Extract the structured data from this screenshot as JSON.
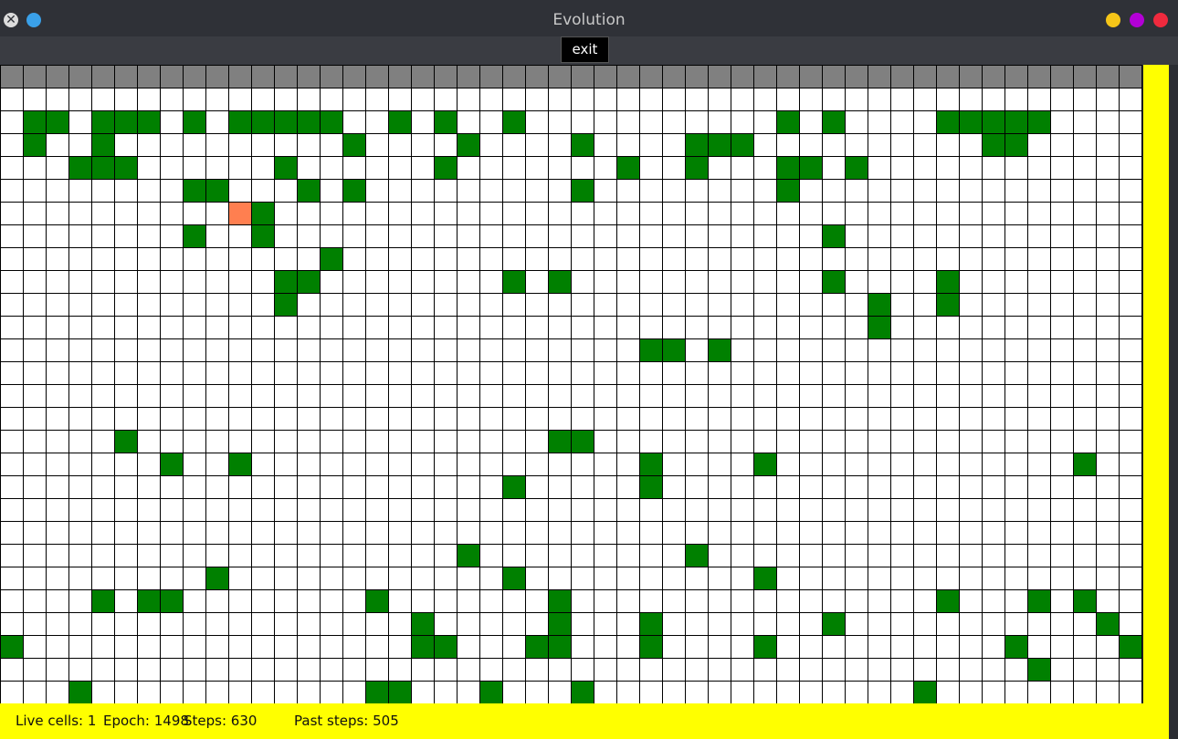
{
  "window": {
    "title": "Evolution",
    "close_icon": "close-icon",
    "left_dot_color": "#3aa0e8",
    "right_dots": [
      "#f5c518",
      "#b300d6",
      "#f02a3e"
    ]
  },
  "toolbar": {
    "exit_label": "exit"
  },
  "board": {
    "columns": 50,
    "rows": 27,
    "colors": {
      "border": "#808080",
      "empty": "#ffffff",
      "live": "#008000",
      "agent": "#ff7f50",
      "grid_line": "#000000",
      "background": "#ffff00"
    },
    "green_cells": [
      [
        1,
        1
      ],
      [
        1,
        2
      ],
      [
        1,
        4
      ],
      [
        1,
        5
      ],
      [
        1,
        6
      ],
      [
        1,
        8
      ],
      [
        1,
        10
      ],
      [
        1,
        11
      ],
      [
        1,
        12
      ],
      [
        1,
        13
      ],
      [
        1,
        14
      ],
      [
        1,
        17
      ],
      [
        1,
        19
      ],
      [
        1,
        22
      ],
      [
        1,
        34
      ],
      [
        1,
        36
      ],
      [
        1,
        41
      ],
      [
        1,
        42
      ],
      [
        1,
        43
      ],
      [
        1,
        44
      ],
      [
        1,
        45
      ],
      [
        2,
        1
      ],
      [
        2,
        4
      ],
      [
        2,
        15
      ],
      [
        2,
        20
      ],
      [
        2,
        25
      ],
      [
        2,
        30
      ],
      [
        2,
        31
      ],
      [
        2,
        32
      ],
      [
        2,
        43
      ],
      [
        2,
        44
      ],
      [
        3,
        3
      ],
      [
        3,
        4
      ],
      [
        3,
        5
      ],
      [
        3,
        12
      ],
      [
        3,
        19
      ],
      [
        3,
        27
      ],
      [
        3,
        30
      ],
      [
        3,
        34
      ],
      [
        3,
        35
      ],
      [
        3,
        37
      ],
      [
        4,
        8
      ],
      [
        4,
        9
      ],
      [
        4,
        13
      ],
      [
        4,
        15
      ],
      [
        4,
        25
      ],
      [
        4,
        34
      ],
      [
        5,
        11
      ],
      [
        6,
        8
      ],
      [
        6,
        11
      ],
      [
        6,
        36
      ],
      [
        7,
        14
      ],
      [
        8,
        12
      ],
      [
        8,
        13
      ],
      [
        8,
        22
      ],
      [
        8,
        24
      ],
      [
        8,
        36
      ],
      [
        8,
        41
      ],
      [
        9,
        12
      ],
      [
        9,
        38
      ],
      [
        9,
        41
      ],
      [
        10,
        38
      ],
      [
        11,
        28
      ],
      [
        11,
        29
      ],
      [
        11,
        31
      ],
      [
        15,
        5
      ],
      [
        15,
        24
      ],
      [
        15,
        25
      ],
      [
        16,
        7
      ],
      [
        16,
        10
      ],
      [
        16,
        28
      ],
      [
        16,
        33
      ],
      [
        16,
        47
      ],
      [
        17,
        22
      ],
      [
        17,
        28
      ],
      [
        20,
        20
      ],
      [
        20,
        30
      ],
      [
        21,
        9
      ],
      [
        21,
        22
      ],
      [
        21,
        33
      ],
      [
        22,
        4
      ],
      [
        22,
        6
      ],
      [
        22,
        7
      ],
      [
        22,
        16
      ],
      [
        22,
        24
      ],
      [
        22,
        41
      ],
      [
        22,
        45
      ],
      [
        22,
        47
      ],
      [
        23,
        18
      ],
      [
        23,
        24
      ],
      [
        23,
        28
      ],
      [
        23,
        36
      ],
      [
        23,
        48
      ],
      [
        24,
        0
      ],
      [
        24,
        18
      ],
      [
        24,
        19
      ],
      [
        24,
        23
      ],
      [
        24,
        24
      ],
      [
        24,
        28
      ],
      [
        24,
        33
      ],
      [
        24,
        44
      ],
      [
        24,
        49
      ],
      [
        25,
        45
      ],
      [
        26,
        3
      ],
      [
        26,
        16
      ],
      [
        26,
        17
      ],
      [
        26,
        21
      ],
      [
        26,
        25
      ],
      [
        26,
        40
      ]
    ],
    "agent_cells": [
      [
        5,
        10
      ]
    ]
  },
  "status": {
    "live_cells": "Live cells: 1",
    "epoch": "Epoch: 1498",
    "steps": "Steps: 630",
    "past_steps": "Past steps: 505"
  }
}
